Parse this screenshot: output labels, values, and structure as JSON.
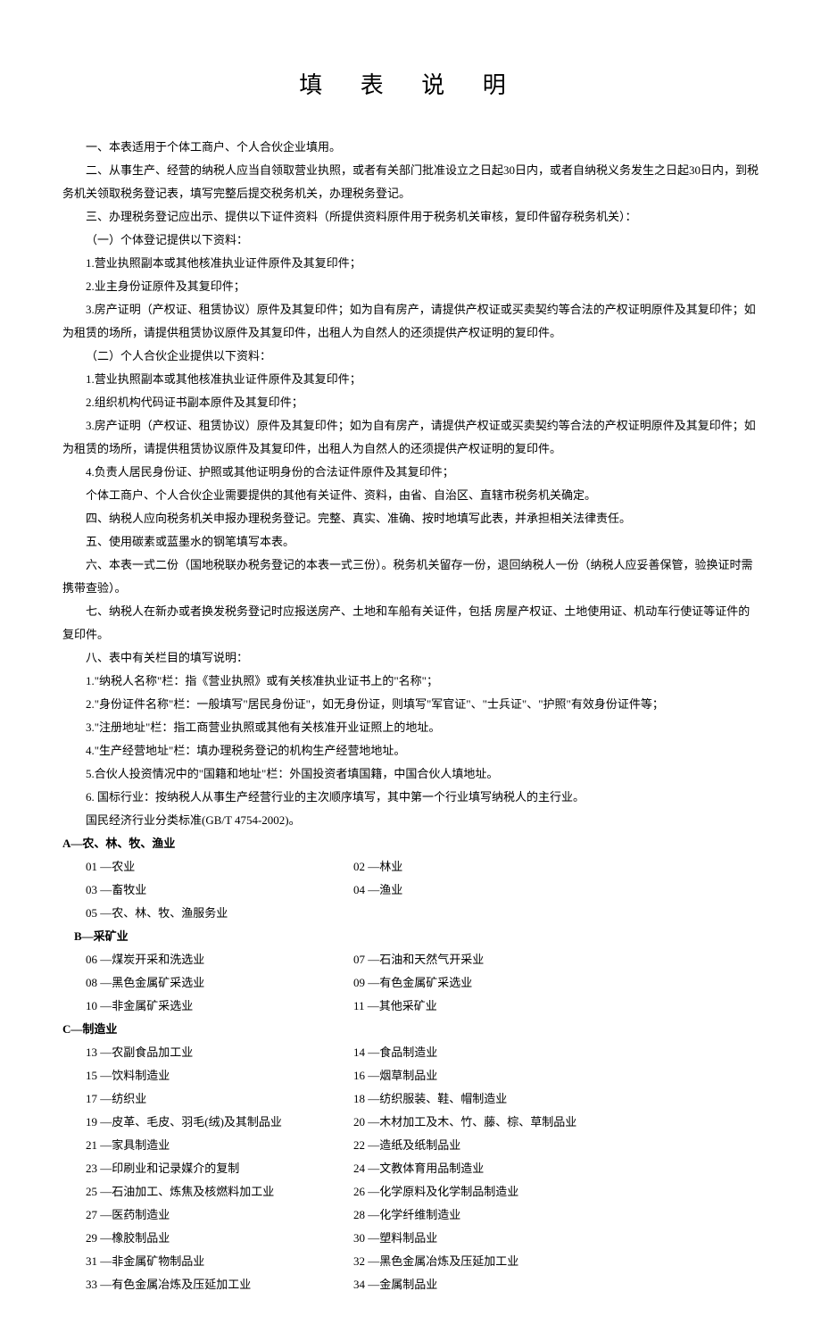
{
  "title": "填 表 说 明",
  "paragraphs": [
    "一、本表适用于个体工商户、个人合伙企业填用。",
    "二、从事生产、经营的纳税人应当自领取营业执照，或者有关部门批准设立之日起30日内，或者自纳税义务发生之日起30日内，到税务机关领取税务登记表，填写完整后提交税务机关，办理税务登记。",
    "三、办理税务登记应出示、提供以下证件资料（所提供资料原件用于税务机关审核，复印件留存税务机关）：",
    "（一）个体登记提供以下资料：",
    "1.营业执照副本或其他核准执业证件原件及其复印件；",
    "2.业主身份证原件及其复印件；",
    "3.房产证明（产权证、租赁协议）原件及其复印件；如为自有房产，请提供产权证或买卖契约等合法的产权证明原件及其复印件；如为租赁的场所，请提供租赁协议原件及其复印件，出租人为自然人的还须提供产权证明的复印件。",
    "（二）个人合伙企业提供以下资料：",
    "1.营业执照副本或其他核准执业证件原件及其复印件；",
    "2.组织机构代码证书副本原件及其复印件；",
    "3.房产证明（产权证、租赁协议）原件及其复印件；如为自有房产，请提供产权证或买卖契约等合法的产权证明原件及其复印件；如为租赁的场所，请提供租赁协议原件及其复印件，出租人为自然人的还须提供产权证明的复印件。",
    "4.负责人居民身份证、护照或其他证明身份的合法证件原件及其复印件；",
    "个体工商户、个人合伙企业需要提供的其他有关证件、资料，由省、自治区、直辖市税务机关确定。",
    "四、纳税人应向税务机关申报办理税务登记。完整、真实、准确、按时地填写此表，并承担相关法律责任。",
    "五、使用碳素或蓝墨水的钢笔填写本表。",
    "六、本表一式二份（国地税联办税务登记的本表一式三份）。税务机关留存一份，退回纳税人一份（纳税人应妥善保管，验换证时需携带查验）。",
    "七、纳税人在新办或者换发税务登记时应报送房产、土地和车船有关证件，包括 房屋产权证、土地使用证、机动车行使证等证件的复印件。",
    "八、表中有关栏目的填写说明：",
    "1.\"纳税人名称\"栏：指《营业执照》或有关核准执业证书上的\"名称\"；",
    "2.\"身份证件名称\"栏：一般填写\"居民身份证\"，如无身份证，则填写\"军官证\"、\"士兵证\"、\"护照\"有效身份证件等；",
    "3.\"注册地址\"栏：指工商营业执照或其他有关核准开业证照上的地址。",
    "4.\"生产经营地址\"栏：填办理税务登记的机构生产经营地地址。",
    "5.合伙人投资情况中的\"国籍和地址\"栏：外国投资者填国籍，中国合伙人填地址。",
    "6. 国标行业：按纳税人从事生产经营行业的主次顺序填写，其中第一个行业填写纳税人的主行业。",
    "国民经济行业分类标准(GB/T 4754-2002)。"
  ],
  "sections": [
    {
      "header": "A—农、林、牧、渔业",
      "items": [
        "01 —农业",
        "02 —林业",
        "03 —畜牧业",
        "04 —渔业",
        "05 —农、林、牧、渔服务业"
      ]
    },
    {
      "header": "B—采矿业",
      "items": [
        "06 —煤炭开采和洗选业",
        "07 —石油和天然气开采业",
        "08 —黑色金属矿采选业",
        "09 —有色金属矿采选业",
        "10 —非金属矿采选业",
        "11 —其他采矿业"
      ]
    },
    {
      "header": "C—制造业",
      "items": [
        "13 —农副食品加工业",
        "14 —食品制造业",
        "15 —饮料制造业",
        "16 —烟草制品业",
        "17 —纺织业",
        "18 —纺织服装、鞋、帽制造业",
        "19 —皮革、毛皮、羽毛(绒)及其制品业",
        "20 —木材加工及木、竹、藤、棕、草制品业",
        "21 —家具制造业",
        "22 —造纸及纸制品业",
        "23 —印刷业和记录媒介的复制",
        "24 —文教体育用品制造业",
        "25 —石油加工、炼焦及核燃料加工业",
        "26 —化学原料及化学制品制造业",
        "27 —医药制造业",
        "28 —化学纤维制造业",
        "29 —橡胶制品业",
        "30 —塑料制品业",
        "31 —非金属矿物制品业",
        "32 —黑色金属冶炼及压延加工业",
        "33 —有色金属冶炼及压延加工业",
        "34 —金属制品业"
      ]
    }
  ]
}
